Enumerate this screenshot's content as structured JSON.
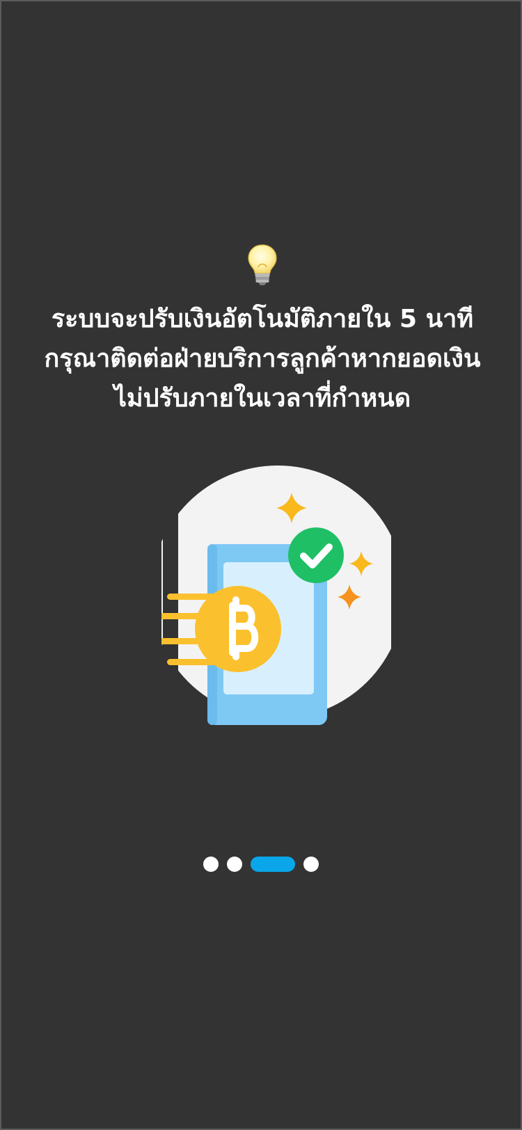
{
  "onboarding": {
    "icon": "light-bulb-icon",
    "message_lines": [
      "ระบบจะปรับเงินอัตโนมัติภายใน 5 นาที",
      "กรุณาติดต่อฝ่ายบริการลูกค้าหากยอดเงิน",
      "ไม่ปรับภายในเวลาที่กำหนด"
    ],
    "illustration": {
      "icon": "mobile-bitcoin-payment-success-icon",
      "coin_symbol": "B"
    },
    "pager": {
      "total_pages": 4,
      "current_page": 3
    }
  },
  "colors": {
    "background": "#333333",
    "text": "#ffffff",
    "active_dot": "#0aa6e9",
    "inactive_dot": "#ffffff",
    "circle": "#f3f3f3",
    "phone_body": "#7ec8f4",
    "phone_screen": "#d8f0fd",
    "coin": "#fbc02d",
    "check": "#1fbf66",
    "sparkle": "#f9b81c",
    "sparkle_alt": "#f5931e"
  }
}
